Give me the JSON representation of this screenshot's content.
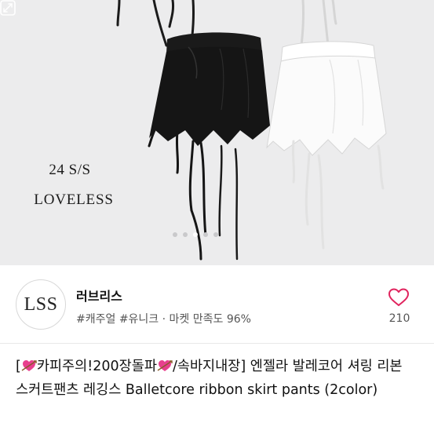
{
  "product_image": {
    "season": "24 S/S",
    "brand_mark": "LOVELESS",
    "carousel": {
      "count": 5,
      "active_index": 2
    }
  },
  "seller": {
    "avatar_text": "LSS",
    "name": "러브리스",
    "tags": "#캐주얼 #유니크 · 마켓 만족도 96%",
    "like_count": "210"
  },
  "product": {
    "title_parts": {
      "bracket_open": "[",
      "part1": "카피주의!200장돌파",
      "part2": "/속바지내장] 엔젤라 발레코어 셔링 리본 스커트팬츠 레깅스 Balletcore ribbon skirt pants (2color)"
    }
  },
  "colors": {
    "accent": "#e0245e",
    "muted": "#555555",
    "divider": "#e8e8e8"
  },
  "icons": {
    "like": "heart-outline-icon",
    "expand": "expand-icon",
    "emoji": "heart-arrow-emoji"
  }
}
